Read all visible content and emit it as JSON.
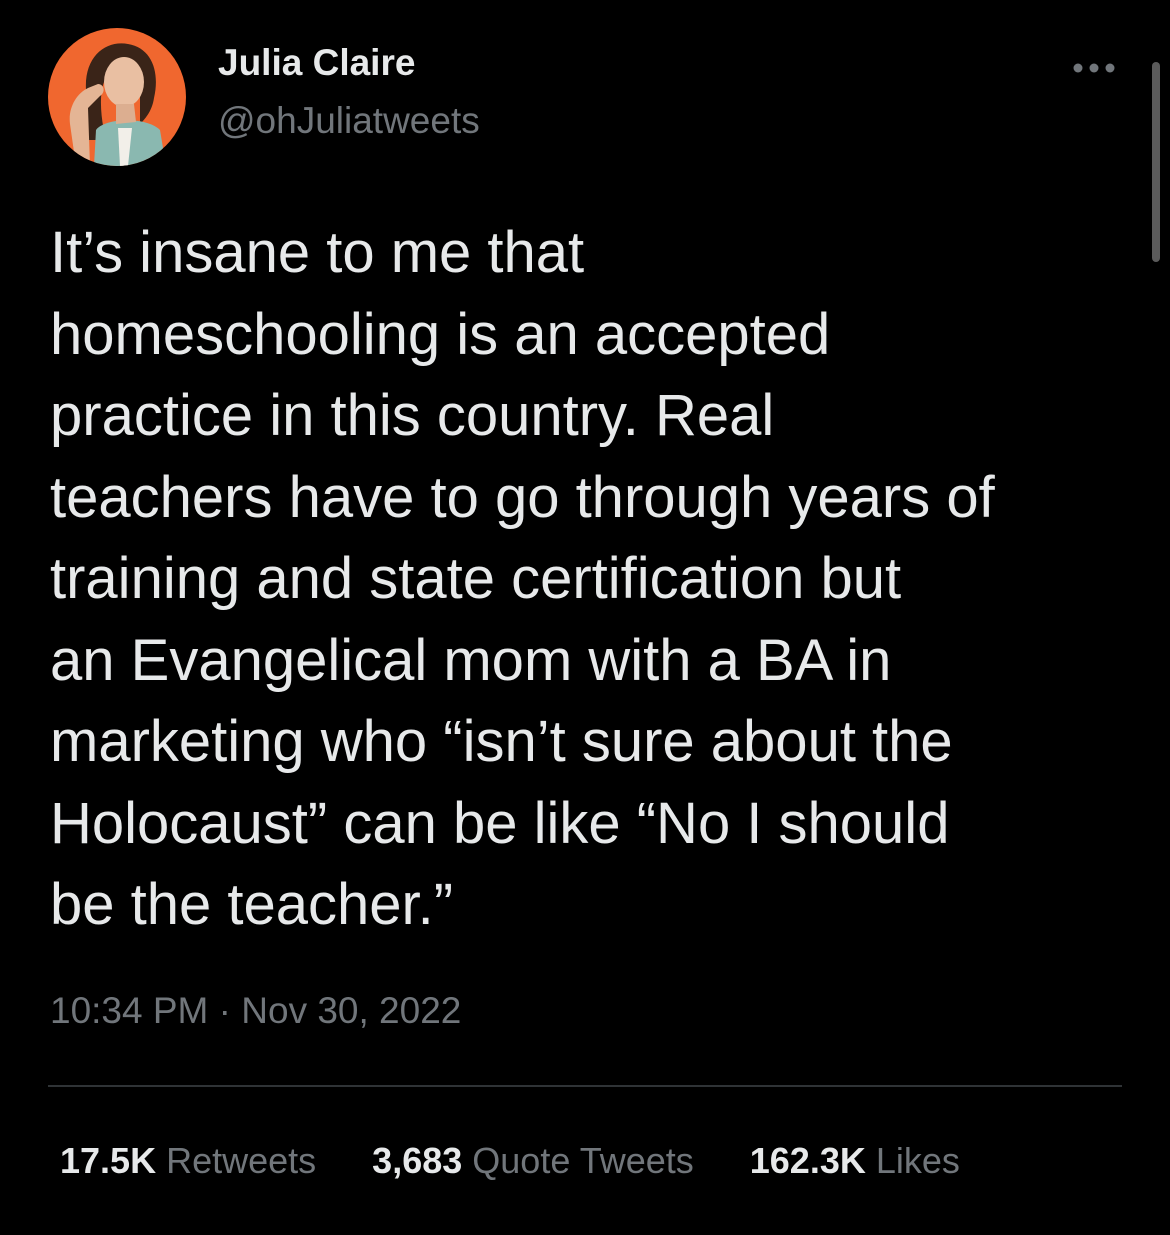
{
  "author": {
    "display_name": "Julia Claire",
    "handle": "@ohJuliatweets"
  },
  "tweet": {
    "lines": [
      "It’s insane to me that",
      "homeschooling is an accepted",
      "practice in this country. Real",
      "teachers have to go through years of",
      "training and state certification but",
      "an Evangelical mom with a BA in",
      "marketing who “isn’t sure about the",
      "Holocaust” can be like “No I should",
      "be the teacher.”"
    ],
    "time": "10:34 PM",
    "separator": "·",
    "date": "Nov 30, 2022"
  },
  "stats": {
    "retweets": {
      "count": "17.5K",
      "label": "Retweets"
    },
    "quotes": {
      "count": "3,683",
      "label": "Quote Tweets"
    },
    "likes": {
      "count": "162.3K",
      "label": "Likes"
    }
  },
  "icons": {
    "more": "more-horizontal-icon",
    "avatar": "profile-photo"
  },
  "colors": {
    "background": "#000000",
    "text_primary": "#e7e9ea",
    "text_secondary": "#71767b",
    "avatar_background": "#f0672f"
  }
}
